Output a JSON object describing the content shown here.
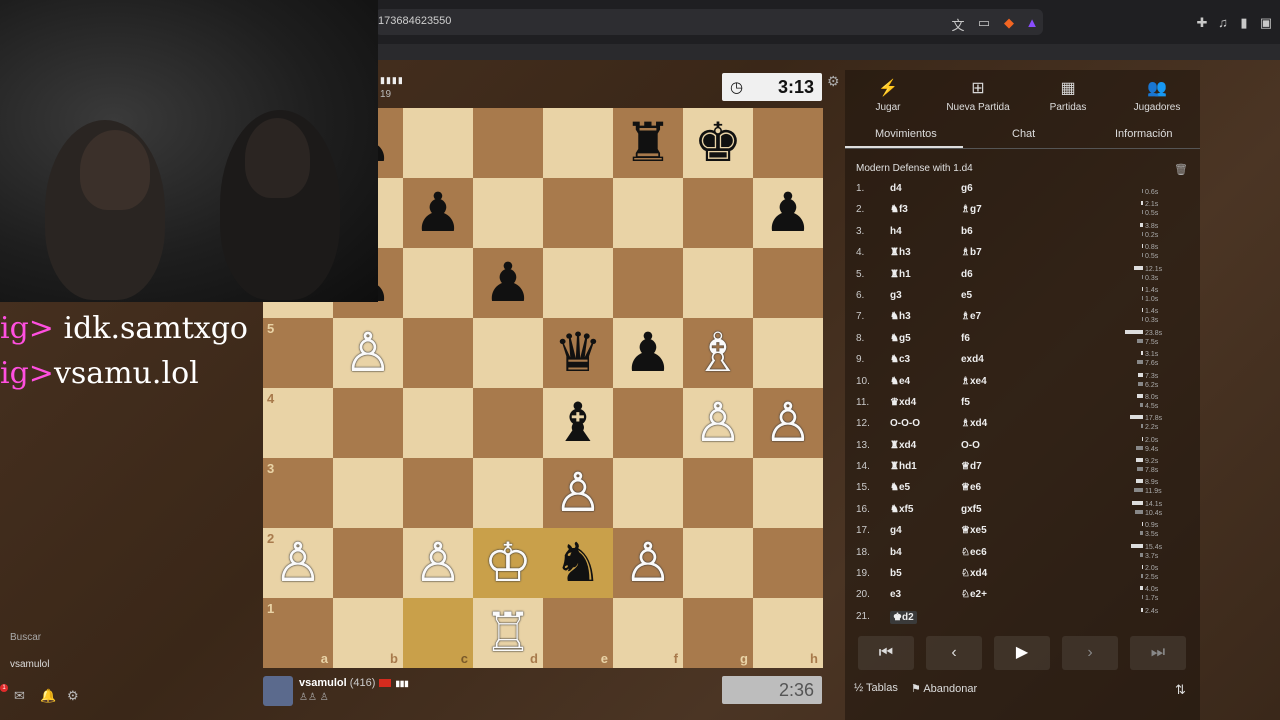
{
  "browser": {
    "url": "173684623550",
    "icons": [
      "translate-icon",
      "cast-icon",
      "brave-shield-icon",
      "rewards-icon",
      "extensions-icon",
      "media-icon",
      "sidebar-icon",
      "wallet-icon"
    ]
  },
  "overlay": {
    "line1_prefix": "ig> ",
    "line1_handle": "idk.samtxgo",
    "line2_prefix": "ig>",
    "line2_handle": "vsamu.lol"
  },
  "top_player": {
    "sub": "19",
    "clock": "3:13"
  },
  "bottom_player": {
    "name": "vsamulol",
    "rating": "(416)",
    "clock": "2:36"
  },
  "board": {
    "ranks": [
      "5",
      "4",
      "3",
      "2",
      "1"
    ],
    "files": [
      "a",
      "b",
      "c",
      "d",
      "e",
      "f",
      "g",
      "h"
    ]
  },
  "nav": {
    "play": "Jugar",
    "new_game": "Nueva Partida",
    "games": "Partidas",
    "players": "Jugadores"
  },
  "tabs": {
    "moves": "Movimientos",
    "chat": "Chat",
    "info": "Información"
  },
  "opening": "Modern Defense with 1.d4",
  "moves": [
    {
      "n": "1.",
      "w": "d4",
      "b": "g6",
      "wt": "",
      "bt": "0.6s"
    },
    {
      "n": "2.",
      "w": "♞f3",
      "b": "♗g7",
      "wt": "2.1s",
      "bt": "0.5s"
    },
    {
      "n": "3.",
      "w": "h4",
      "b": "b6",
      "wt": "3.8s",
      "bt": "0.2s"
    },
    {
      "n": "4.",
      "w": "♜h3",
      "b": "♗b7",
      "wt": "0.8s",
      "bt": "0.5s"
    },
    {
      "n": "5.",
      "w": "♜h1",
      "b": "d6",
      "wt": "12.1s",
      "bt": "0.3s"
    },
    {
      "n": "6.",
      "w": "g3",
      "b": "e5",
      "wt": "1.4s",
      "bt": "1.0s"
    },
    {
      "n": "7.",
      "w": "♞h3",
      "b": "♗e7",
      "wt": "1.4s",
      "bt": "0.3s"
    },
    {
      "n": "8.",
      "w": "♞g5",
      "b": "f6",
      "wt": "23.8s",
      "bt": "7.5s"
    },
    {
      "n": "9.",
      "w": "♞c3",
      "b": "exd4",
      "wt": "3.1s",
      "bt": "7.6s"
    },
    {
      "n": "10.",
      "w": "♞e4",
      "b": "♗xe4",
      "wt": "7.3s",
      "bt": "6.2s"
    },
    {
      "n": "11.",
      "w": "♛xd4",
      "b": "f5",
      "wt": "8.0s",
      "bt": "4.5s"
    },
    {
      "n": "12.",
      "w": "O-O-O",
      "b": "♗xd4",
      "wt": "17.8s",
      "bt": "2.2s"
    },
    {
      "n": "13.",
      "w": "♜xd4",
      "b": "O-O",
      "wt": "2.0s",
      "bt": "9.4s"
    },
    {
      "n": "14.",
      "w": "♜hd1",
      "b": "♕d7",
      "wt": "9.2s",
      "bt": "7.8s"
    },
    {
      "n": "15.",
      "w": "♞e5",
      "b": "♕e6",
      "wt": "8.9s",
      "bt": "11.9s"
    },
    {
      "n": "16.",
      "w": "♞xf5",
      "b": "gxf5",
      "wt": "14.1s",
      "bt": "10.4s"
    },
    {
      "n": "17.",
      "w": "g4",
      "b": "♕xe5",
      "wt": "0.9s",
      "bt": "3.5s"
    },
    {
      "n": "18.",
      "w": "b4",
      "b": "♘ec6",
      "wt": "15.4s",
      "bt": "3.7s"
    },
    {
      "n": "19.",
      "w": "b5",
      "b": "♘xd4",
      "wt": "2.0s",
      "bt": "2.5s"
    },
    {
      "n": "20.",
      "w": "e3",
      "b": "♘e2+",
      "wt": "4.0s",
      "bt": "1.7s"
    },
    {
      "n": "21.",
      "w": "♚d2",
      "b": "",
      "wt": "2.4s",
      "bt": ""
    }
  ],
  "actions": {
    "draw": "Tablas",
    "resign": "Abandonar",
    "half": "½"
  },
  "sidebar": {
    "search": "Buscar",
    "user": "vsamulol",
    "badge": "1"
  }
}
